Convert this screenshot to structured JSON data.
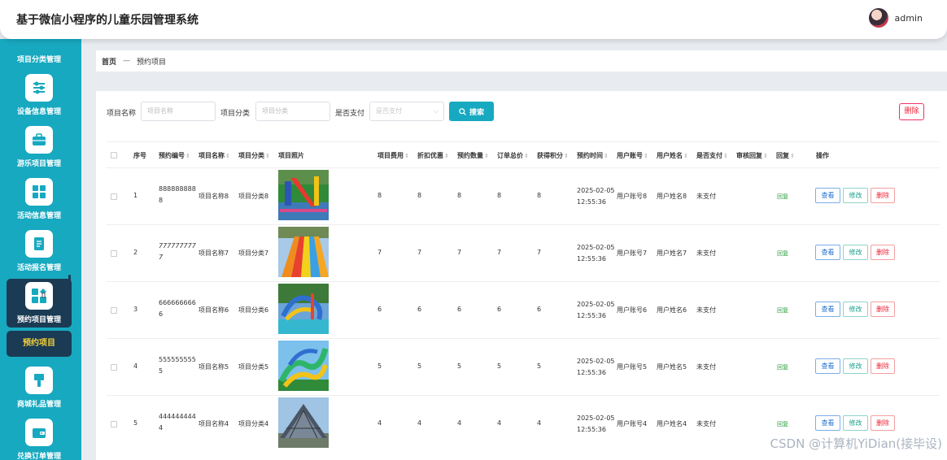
{
  "header": {
    "title": "基于微信小程序的儿童乐园管理系统",
    "username": "admin"
  },
  "sidebar": {
    "section_title": "项目分类管理",
    "items": [
      {
        "label": "设备信息管理",
        "icon": "sliders-icon"
      },
      {
        "label": "游乐项目管理",
        "icon": "briefcase-icon"
      },
      {
        "label": "活动信息管理",
        "icon": "grid-icon"
      },
      {
        "label": "活动报名管理",
        "icon": "document-icon"
      },
      {
        "label": "预约项目管理",
        "icon": "apps-icon"
      },
      {
        "label": "商城礼品管理",
        "icon": "brush-icon"
      },
      {
        "label": "兑换订单管理",
        "icon": "wallet-icon"
      }
    ],
    "sub_item": "预约项目"
  },
  "breadcrumb": {
    "home": "首页",
    "sep": "—",
    "current": "预约项目"
  },
  "search": {
    "name_label": "项目名称",
    "name_placeholder": "项目名称",
    "category_label": "项目分类",
    "category_placeholder": "项目分类",
    "paid_label": "是否支付",
    "paid_placeholder": "是否支付",
    "search_button": "搜索",
    "delete_button": "删除"
  },
  "table": {
    "columns": [
      "序号",
      "预约编号",
      "项目名称",
      "项目分类",
      "项目照片",
      "项目费用",
      "折扣优惠",
      "预约数量",
      "订单总价",
      "获得积分",
      "预约时间",
      "用户账号",
      "用户姓名",
      "是否支付",
      "审核回复",
      "回复",
      "操作"
    ],
    "actions": {
      "view": "查看",
      "edit": "修改",
      "delete": "删除"
    },
    "rows": [
      {
        "no": "1",
        "code1": "888888888",
        "code2": "8",
        "name": "项目名称8",
        "cat": "项目分类8",
        "fee": "8",
        "discount": "8",
        "qty": "8",
        "total": "8",
        "points": "8",
        "date": "2025-02-05",
        "time": "12:55:36",
        "account": "用户账号8",
        "uname": "用户姓名8",
        "paid": "未支付",
        "reply": "回复"
      },
      {
        "no": "2",
        "code1": "777777777",
        "code2": "7",
        "name": "项目名称7",
        "cat": "项目分类7",
        "fee": "7",
        "discount": "7",
        "qty": "7",
        "total": "7",
        "points": "7",
        "date": "2025-02-05",
        "time": "12:55:36",
        "account": "用户账号7",
        "uname": "用户姓名7",
        "paid": "未支付",
        "reply": "回复"
      },
      {
        "no": "3",
        "code1": "666666666",
        "code2": "6",
        "name": "项目名称6",
        "cat": "项目分类6",
        "fee": "6",
        "discount": "6",
        "qty": "6",
        "total": "6",
        "points": "6",
        "date": "2025-02-05",
        "time": "12:55:36",
        "account": "用户账号6",
        "uname": "用户姓名6",
        "paid": "未支付",
        "reply": "回复"
      },
      {
        "no": "4",
        "code1": "555555555",
        "code2": "5",
        "name": "项目名称5",
        "cat": "项目分类5",
        "fee": "5",
        "discount": "5",
        "qty": "5",
        "total": "5",
        "points": "5",
        "date": "2025-02-05",
        "time": "12:55:36",
        "account": "用户账号5",
        "uname": "用户姓名5",
        "paid": "未支付",
        "reply": "回复"
      },
      {
        "no": "5",
        "code1": "444444444",
        "code2": "4",
        "name": "项目名称4",
        "cat": "项目分类4",
        "fee": "4",
        "discount": "4",
        "qty": "4",
        "total": "4",
        "points": "4",
        "date": "2025-02-05",
        "time": "12:55:36",
        "account": "用户账号4",
        "uname": "用户姓名4",
        "paid": "未支付",
        "reply": "回复"
      }
    ]
  },
  "watermark": "CSDN @计算机YiDian(接毕设)"
}
